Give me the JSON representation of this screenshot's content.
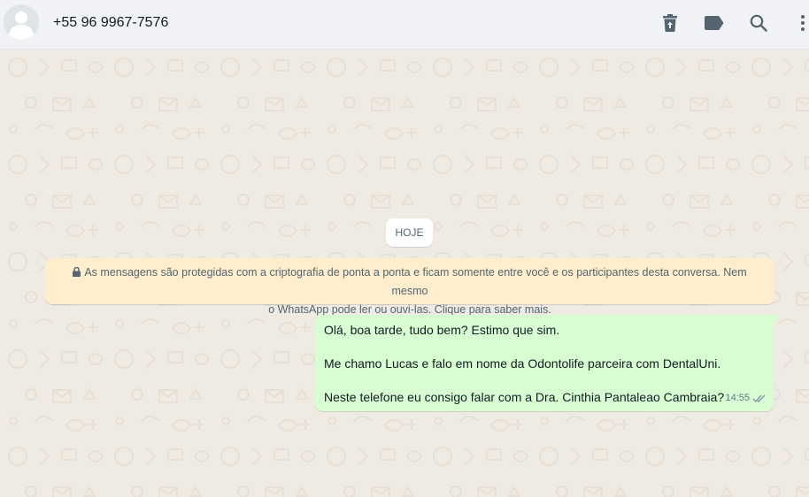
{
  "header": {
    "contact_name": "+55 96 9967-7576",
    "icons": [
      "delete-icon",
      "label-icon",
      "search-icon",
      "menu-icon"
    ]
  },
  "chat": {
    "date_label": "HOJE",
    "encryption_line1": "As mensagens são protegidas com a criptografia de ponta a ponta e ficam somente entre você e os participantes desta conversa. Nem mesmo",
    "encryption_line2": "o WhatsApp pode ler ou ouvi-las. Clique para saber mais.",
    "message": {
      "line1": "Olá, boa tarde, tudo bem? Estimo que sim.",
      "line2": "Me chamo Lucas e falo em nome da Odontolife parceira com DentalUni.",
      "line3": "Neste telefone eu consigo falar com a Dra. Cinthia Pantaleao Cambraia?",
      "time": "14:55",
      "status_icon": "double-check-icon"
    }
  },
  "colors": {
    "header_bg": "#f0f2f5",
    "chat_bg": "#efeae2",
    "outgoing_bubble": "#d9fdd3",
    "encryption_bg": "#ffeecd",
    "icon": "#54656f"
  }
}
